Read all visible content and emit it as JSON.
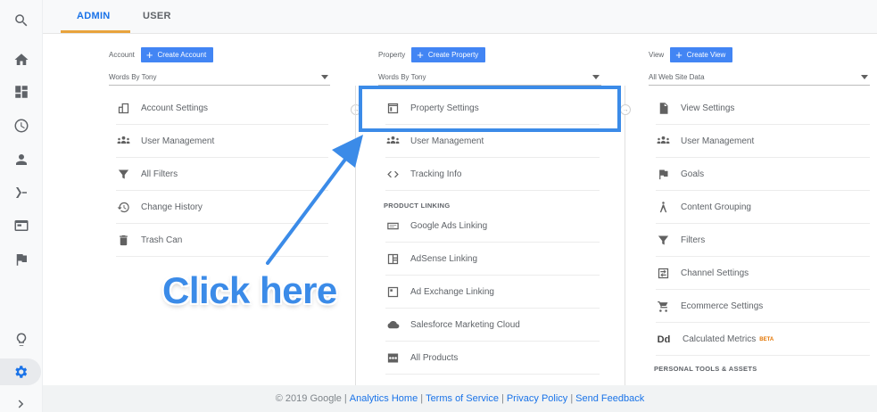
{
  "tabs": {
    "admin": "ADMIN",
    "user": "USER"
  },
  "account": {
    "label": "Account",
    "create": "Create Account",
    "selected": "Words By Tony",
    "items": [
      {
        "label": "Account Settings",
        "icon": "building-icon"
      },
      {
        "label": "User Management",
        "icon": "people-icon"
      },
      {
        "label": "All Filters",
        "icon": "filter-icon"
      },
      {
        "label": "Change History",
        "icon": "history-icon"
      },
      {
        "label": "Trash Can",
        "icon": "trash-icon"
      }
    ]
  },
  "property": {
    "label": "Property",
    "create": "Create Property",
    "selected": "Words By Tony",
    "items": [
      {
        "label": "Property Settings",
        "icon": "window-icon"
      },
      {
        "label": "User Management",
        "icon": "people-icon"
      },
      {
        "label": "Tracking Info",
        "icon": "code-icon"
      }
    ],
    "section": "PRODUCT LINKING",
    "linking": [
      {
        "label": "Google Ads Linking",
        "icon": "ads-icon"
      },
      {
        "label": "AdSense Linking",
        "icon": "adsense-icon"
      },
      {
        "label": "Ad Exchange Linking",
        "icon": "adexchange-icon"
      },
      {
        "label": "Salesforce Marketing Cloud",
        "icon": "cloud-icon"
      },
      {
        "label": "All Products",
        "icon": "products-icon"
      }
    ]
  },
  "view": {
    "label": "View",
    "create": "Create View",
    "selected": "All Web Site Data",
    "items": [
      {
        "label": "View Settings",
        "icon": "document-icon"
      },
      {
        "label": "User Management",
        "icon": "people-icon"
      },
      {
        "label": "Goals",
        "icon": "flag-icon"
      },
      {
        "label": "Content Grouping",
        "icon": "grouping-icon"
      },
      {
        "label": "Filters",
        "icon": "filter-icon"
      },
      {
        "label": "Channel Settings",
        "icon": "channel-icon"
      },
      {
        "label": "Ecommerce Settings",
        "icon": "cart-icon"
      },
      {
        "label": "Calculated Metrics",
        "icon": "dd-icon",
        "badge": "BETA"
      }
    ],
    "section": "PERSONAL TOOLS & ASSETS"
  },
  "annotation": {
    "text": "Click here",
    "color": "#3b8be8"
  },
  "footer": {
    "copyright": "© 2019 Google",
    "links": [
      "Analytics Home",
      "Terms of Service",
      "Privacy Policy",
      "Send Feedback"
    ]
  },
  "colors": {
    "accent": "#1a73e8",
    "button": "#4285f4",
    "tab_underline": "#e8a33d"
  }
}
